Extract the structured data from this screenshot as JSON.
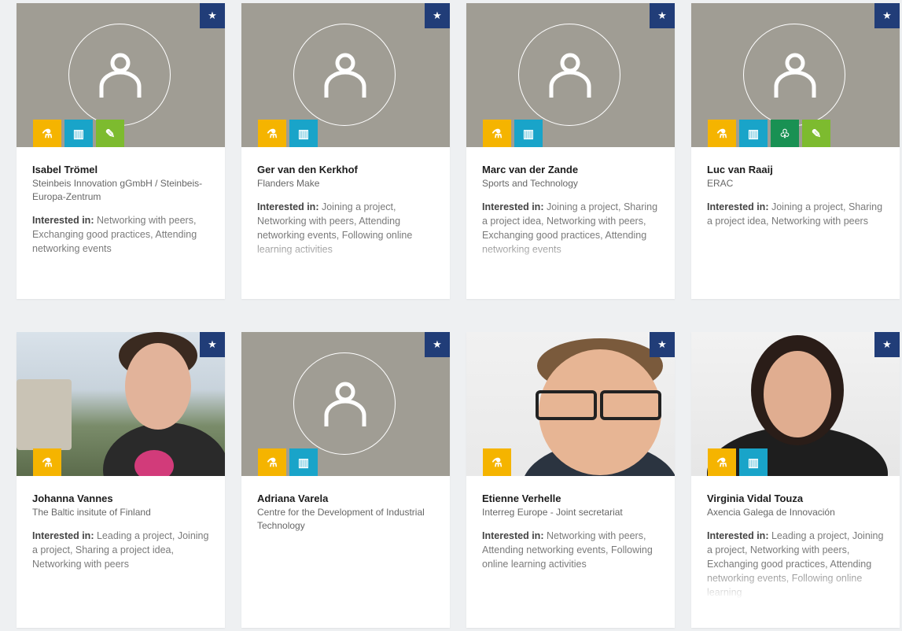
{
  "icons": {
    "favorite": "star-icon",
    "avatar": "person-icon",
    "topics": {
      "rd": "research-icon",
      "industry": "industry-icon",
      "environment": "tree-icon",
      "economy": "growth-icon"
    }
  },
  "colors": {
    "favorite": "#213d78",
    "rd": "#f5b400",
    "industry": "#19a4c9",
    "environment": "#199153",
    "economy": "#7dbb2f",
    "placeholder": "#a09d94"
  },
  "interest_label": "Interested in:",
  "fav_symbol": "★",
  "cards": [
    {
      "name": "Isabel Trömel",
      "org": "Steinbeis Innovation gGmbH / Steinbeis-Europa-Zentrum",
      "interests": "Networking with peers, Exchanging good practices, Attending networking events"
    },
    {
      "name": "Ger van den Kerkhof",
      "org": "Flanders Make",
      "interests": "Joining a project, Networking with peers, Attending networking events, Following online learning activities"
    },
    {
      "name": "Marc van der Zande",
      "org": "Sports and Technology",
      "interests": "Joining a project, Sharing a project idea, Networking with peers, Exchanging good practices, Attending networking events"
    },
    {
      "name": "Luc van Raaij",
      "org": "ERAC",
      "interests": "Joining a project, Sharing a project idea, Networking with peers"
    },
    {
      "name": "Johanna Vannes",
      "org": "The Baltic insitute of Finland",
      "interests": "Leading a project, Joining a project, Sharing a project idea, Networking with peers"
    },
    {
      "name": "Adriana Varela",
      "org": "Centre for the Development of Industrial Technology",
      "interests": ""
    },
    {
      "name": "Etienne Verhelle",
      "org": "Interreg Europe - Joint secretariat",
      "interests": "Networking with peers, Attending networking events, Following online learning activities"
    },
    {
      "name": "Virginia Vidal Touza",
      "org": "Axencia Galega de Innovación",
      "interests": "Leading a project, Joining a project, Networking with peers, Exchanging good practices, Attending networking events, Following online learning"
    }
  ]
}
